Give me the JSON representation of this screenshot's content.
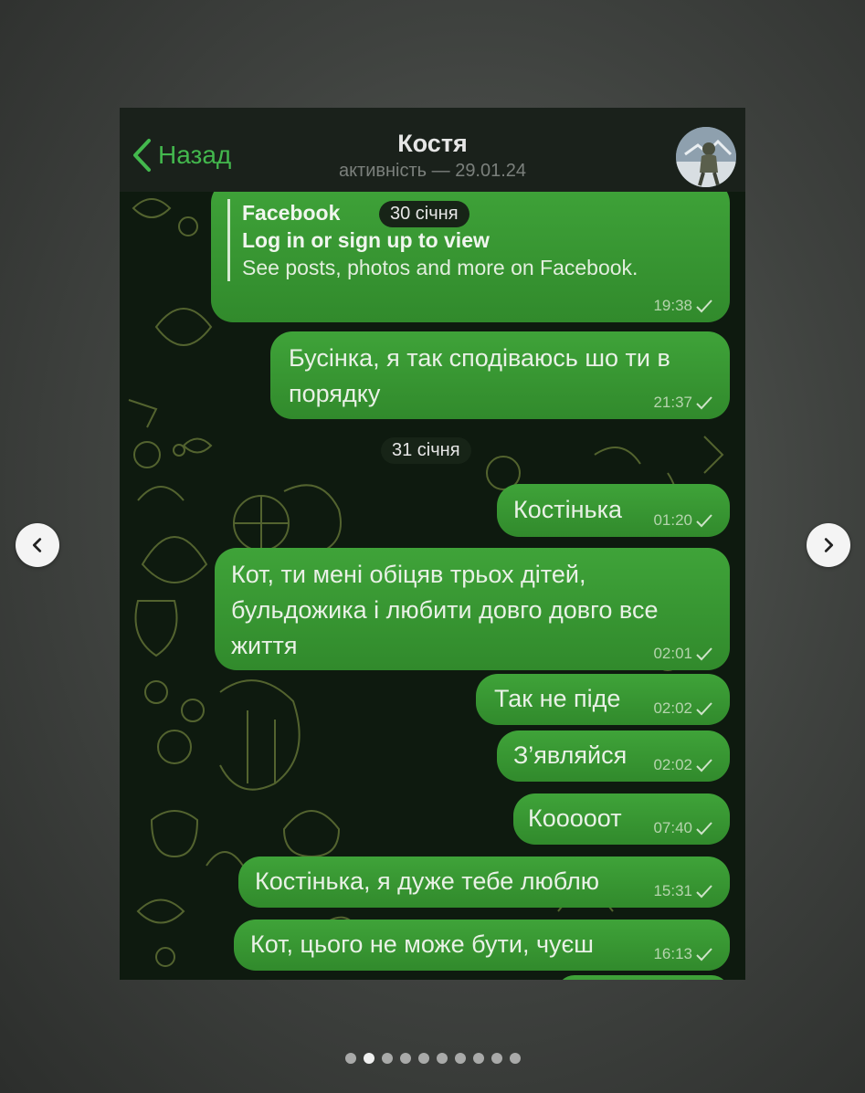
{
  "carousel": {
    "prev_icon": "chevron-left-icon",
    "next_icon": "chevron-right-icon",
    "dots_total": 10,
    "active_index": 1
  },
  "header": {
    "back_label": "Назад",
    "contact_name": "Костя",
    "last_seen": "активність — 29.01.24",
    "accent_color": "#43b84d"
  },
  "dates": [
    "30 січня",
    "31 січня"
  ],
  "link_preview": {
    "site": "Facebook",
    "headline": "Log in or sign up to view",
    "description": "See posts, photos and more on Facebook.",
    "time": "19:38"
  },
  "messages": [
    {
      "text": "Бусінка, я так сподіваюсь шо ти в порядку",
      "time": "21:37"
    },
    {
      "text": "Костінька",
      "time": "01:20"
    },
    {
      "text": "Кот, ти мені обіцяв трьох дітей, бульдожика і любити довго довго все життя",
      "time": "02:01"
    },
    {
      "text": "Так не піде",
      "time": "02:02"
    },
    {
      "text": "З’являйся",
      "time": "02:02"
    },
    {
      "text": "Кооооот",
      "time": "07:40"
    },
    {
      "text": "Костінька, я дуже тебе люблю",
      "time": "15:31"
    },
    {
      "text": "Кот, цього не може бути, чуєш",
      "time": "16:13"
    }
  ],
  "colors": {
    "bubble": "#3a9a34",
    "header_bg": "#1a211b",
    "chat_bg": "#0d1a0e"
  }
}
